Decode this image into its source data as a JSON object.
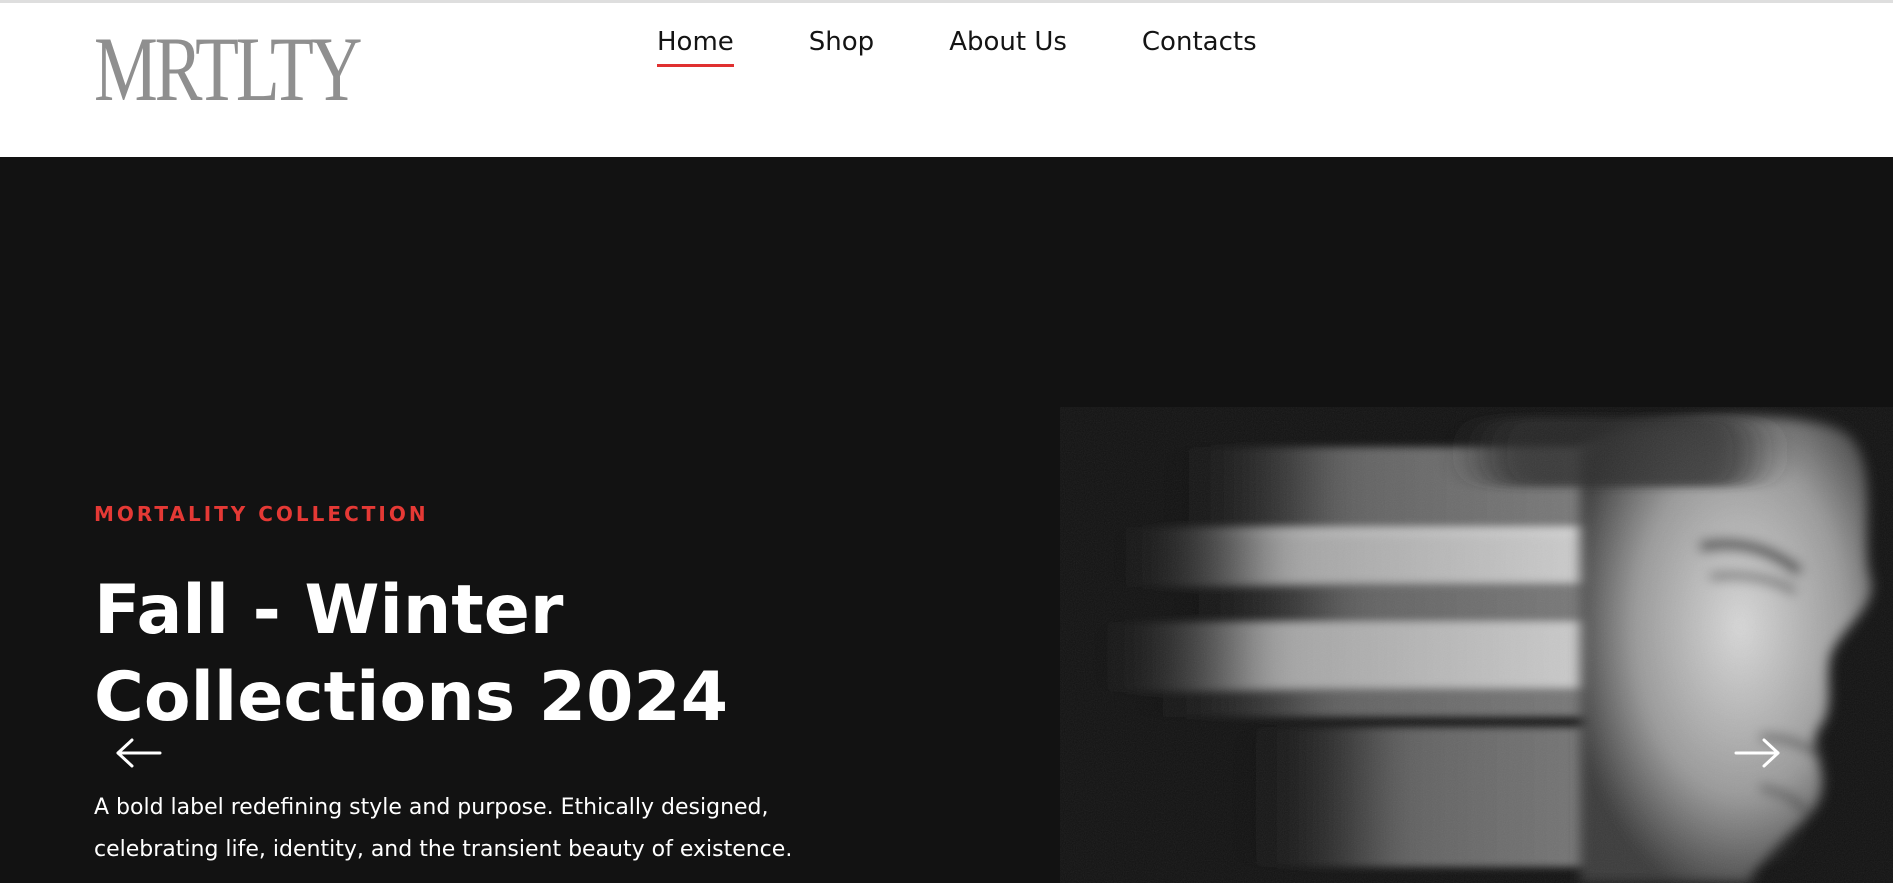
{
  "header": {
    "logo_text": "MRTLTY",
    "nav": [
      {
        "label": "Home",
        "active": true
      },
      {
        "label": "Shop",
        "active": false
      },
      {
        "label": "About Us",
        "active": false
      },
      {
        "label": "Contacts",
        "active": false
      }
    ]
  },
  "hero": {
    "eyebrow": "MORTALITY COLLECTION",
    "headline_line1": "Fall - Winter",
    "headline_line2": "Collections 2024",
    "description_line1": "A bold label redefining style and purpose. Ethically designed,",
    "description_line2": "celebrating life, identity, and the transient beauty of existence.",
    "prev_icon": "arrow-left-icon",
    "next_icon": "arrow-right-icon",
    "image": "motion-blurred-face-photo"
  },
  "colors": {
    "accent": "#e53935",
    "hero_bg": "#121212",
    "nav_text": "#141414",
    "logo": "#8f8f8f"
  }
}
